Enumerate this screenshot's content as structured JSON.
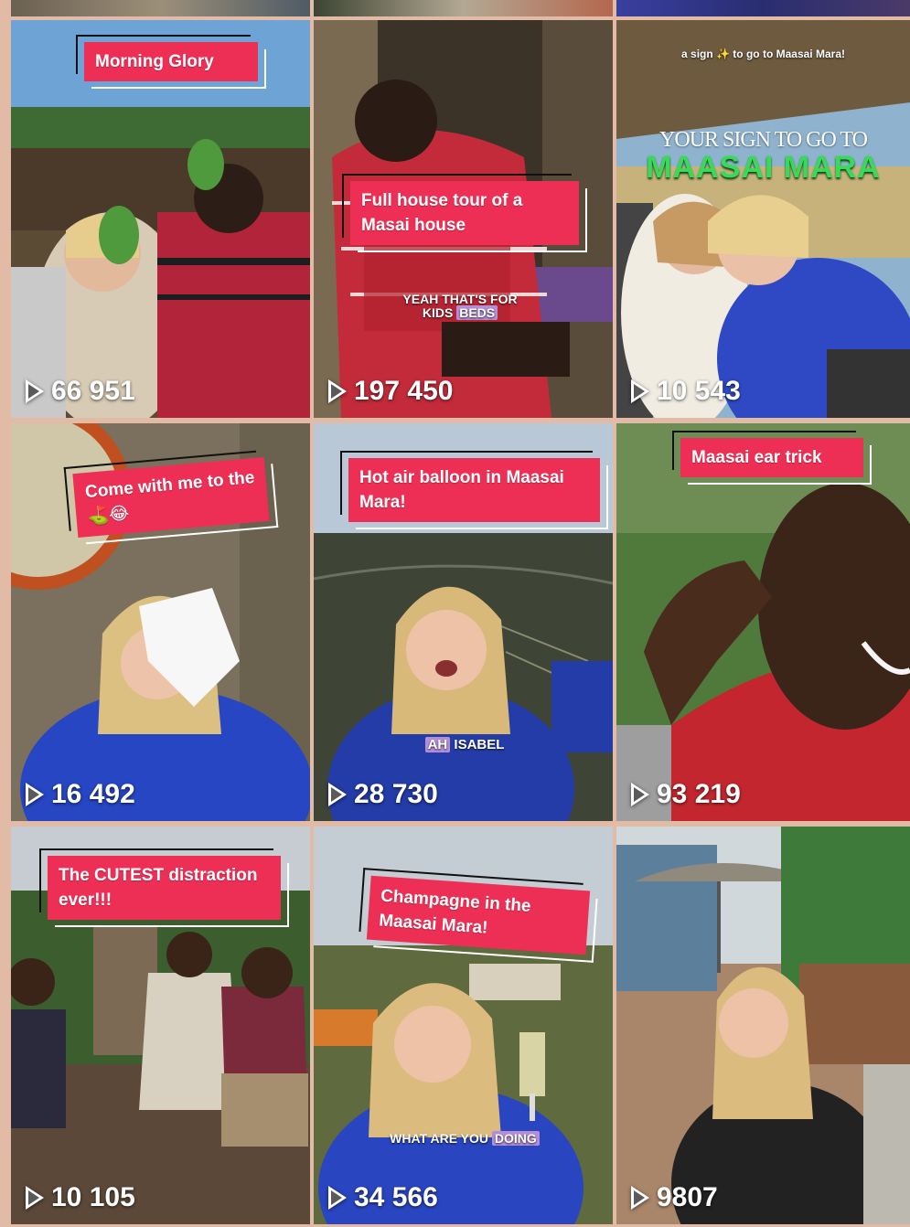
{
  "grid": {
    "tiles": [
      {
        "caption": "Morning Glory",
        "plays": "66 951"
      },
      {
        "caption": "Full house tour of a Masai house",
        "plays": "197 450",
        "subtitle": {
          "line1": "YEAH THAT'S FOR",
          "line2_pre": "KIDS ",
          "line2_hl": "BEDS"
        }
      },
      {
        "plays": "10 543",
        "overlay": {
          "small": "a sign ✨ to go to Maasai Mara!",
          "sign_line": "YOUR SIGN TO GO TO",
          "title": "MAASAI MARA"
        }
      },
      {
        "caption": "Come with me to the ⛳😂",
        "plays": "16 492"
      },
      {
        "caption": "Hot air balloon in Maasai Mara!",
        "plays": "28 730",
        "subtitle": {
          "hl": "AH",
          "rest": " ISABEL"
        }
      },
      {
        "caption": "Maasai ear trick",
        "plays": "93 219"
      },
      {
        "caption": "The CUTEST distraction ever!!!",
        "plays": "10 105"
      },
      {
        "caption": "Champagne in the Maasai Mara!",
        "plays": "34 566",
        "subtitle": {
          "pre": "WHAT ARE YOU ",
          "hl": "DOING"
        }
      },
      {
        "plays": "9807"
      }
    ]
  },
  "colors": {
    "background": "#e2bba7",
    "caption_bg": "#ee2f55",
    "subtitle_highlight": "#b48fd8",
    "maasai_mara_title": "#39d95a"
  },
  "icons": {
    "play": "play-triangle-icon"
  }
}
